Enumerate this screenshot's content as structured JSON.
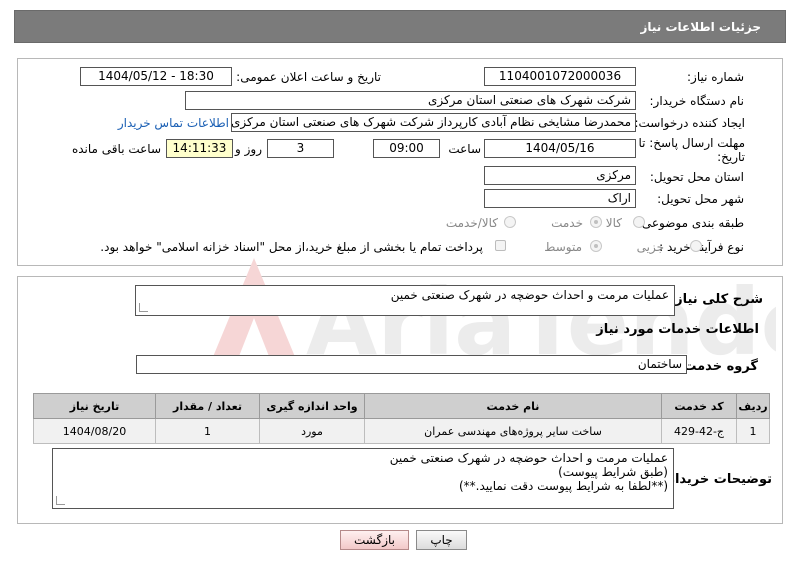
{
  "header": {
    "title": "جزئیات اطلاعات نیاز"
  },
  "form": {
    "need_number": {
      "label": "شماره نیاز:",
      "value": "1104001072000036"
    },
    "announce": {
      "label": "تاریخ و ساعت اعلان عمومی:",
      "value": "1404/05/12 - 18:30"
    },
    "buyer_org": {
      "label": "نام دستگاه خریدار:",
      "value": "شرکت شهرک های صنعتی استان مرکزی"
    },
    "creator": {
      "label": "ایجاد کننده درخواست:",
      "value": "محمدرضا مشایخی نظام آبادی کارپرداز شرکت شهرک های صنعتی استان مرکزی",
      "contact_link": "اطلاعات تماس خریدار"
    },
    "deadline": {
      "label": "مهلت ارسال پاسخ: تا تاریخ:",
      "date": "1404/05/16",
      "time_label": "ساعت",
      "time": "09:00",
      "days": "3",
      "days_label": "روز و",
      "remaining": "14:11:33",
      "remaining_label": "ساعت باقی مانده"
    },
    "province": {
      "label": "استان محل تحویل:",
      "value": "مرکزی"
    },
    "city": {
      "label": "شهر محل تحویل:",
      "value": "اراک"
    },
    "category": {
      "label": "طبقه بندی موضوعی:",
      "options": [
        "کالا",
        "خدمت",
        "کالا/خدمت"
      ],
      "selected": "خدمت"
    },
    "process": {
      "label": "نوع فرآیند خرید :",
      "options": [
        "جزیی",
        "متوسط"
      ],
      "selected": "متوسط",
      "payment_note": "پرداخت تمام یا بخشی از مبلغ خرید،از محل \"اسناد خزانه اسلامی\" خواهد بود."
    }
  },
  "summary": {
    "label": "شرح کلی نیاز:",
    "value": "عملیات مرمت و احداث حوضچه در شهرک صنعتی خمین",
    "services_title": "اطلاعات خدمات مورد نیاز",
    "group_label": "گروه خدمت:",
    "group_value": "ساختمان"
  },
  "table": {
    "headers": [
      "ردیف",
      "کد خدمت",
      "نام خدمت",
      "واحد اندازه گیری",
      "تعداد / مقدار",
      "تاریخ نیاز"
    ],
    "rows": [
      [
        "1",
        "ج-42-429",
        "ساخت سایر پروژه‌های مهندسی عمران",
        "مورد",
        "1",
        "1404/08/20"
      ]
    ]
  },
  "buyer_notes": {
    "label": "توضیحات خریدار:",
    "lines": [
      "عملیات مرمت و احداث حوضچه در شهرک صنعتی خمین",
      "(طبق شرایط پیوست)",
      "(**لطفا به شرایط پیوست دقت نمایید.**)"
    ]
  },
  "buttons": {
    "print": "چاپ",
    "back": "بازگشت"
  },
  "colors": {
    "header_bg": "#7b7b7b",
    "link": "#1a5fb4",
    "time_box": "#ffffcc",
    "table_header": "#cfcfcf"
  }
}
